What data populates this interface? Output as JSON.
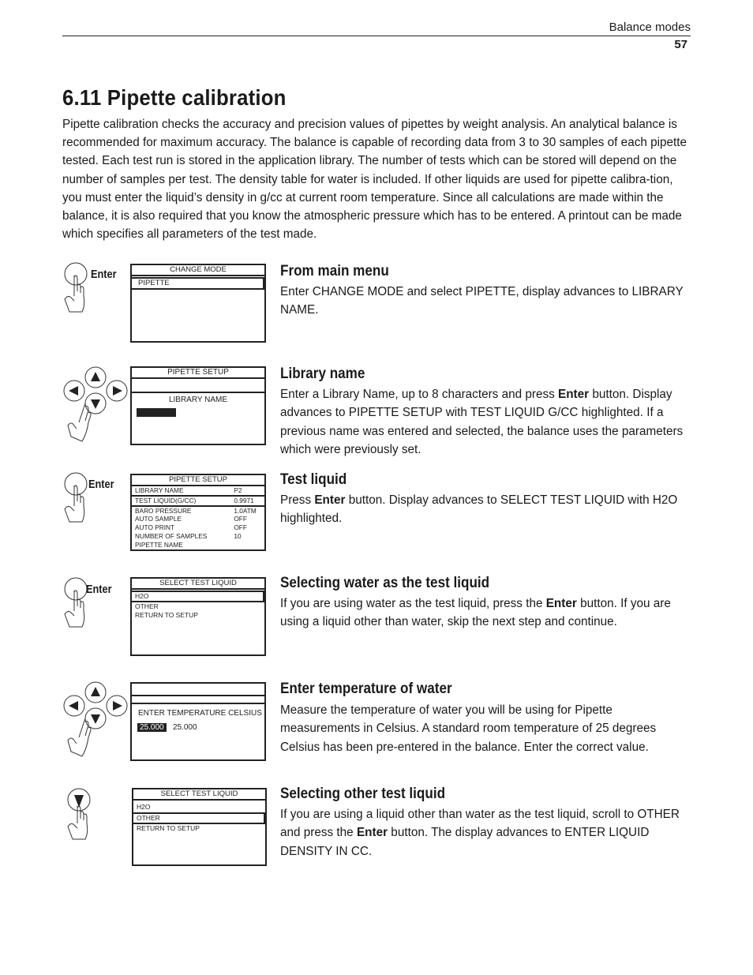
{
  "header": {
    "section": "Balance modes",
    "page_number": "57"
  },
  "title": "6.11 Pipette calibration",
  "intro": "Pipette calibration checks the accuracy and precision values of pipettes by weight analysis. An analytical balance is recommended for maximum accuracy. The balance is capable of recording data from 3 to 30 samples of each pipette tested. Each test run is stored in the application library. The number of tests which can be stored will depend on the number of samples per test. The density table for water is included. If other liquids are used for pipette calibra-tion, you must enter the liquid’s density in g/cc at current room temperature. Since all calculations are made within the balance, it is also required that you know the atmospheric pressure which has to be entered. A printout can be made which specifies all parameters of the test made.",
  "steps": [
    {
      "heading": "From main menu",
      "text": "Enter CHANGE MODE and select PIPETTE, display advances to LIBRARY NAME.",
      "key": {
        "type": "enter-button",
        "label": "Enter"
      },
      "display": {
        "header": "CHANGE MODE",
        "rows": [
          "PIPETTE"
        ],
        "selected": "PIPETTE"
      }
    },
    {
      "heading": "Library name",
      "text_parts": [
        "Enter a Library Name, up to 8 characters and press ",
        "Enter",
        " button. Display advances to PIPETTE SETUP with TEST LIQUID G/CC highlighted. If a previous name was entered and selected, the balance uses the parameters which were previously set."
      ],
      "key": {
        "type": "arrow-keypad"
      },
      "display": {
        "header": "PIPETTE SETUP",
        "prompt": "LIBRARY NAME",
        "input_value": ""
      }
    },
    {
      "heading": "Test liquid",
      "text_parts": [
        "Press ",
        "Enter",
        " button. Display advances to SELECT TEST LIQUID with H2O highlighted."
      ],
      "key": {
        "type": "enter-button",
        "label": "Enter"
      },
      "display": {
        "header": "PIPETTE SETUP",
        "rows": [
          {
            "label": "LIBRARY NAME",
            "value": "P2"
          },
          {
            "label": "TEST LIQUID(G/CC)",
            "value": "0.9971"
          },
          {
            "label": "BARO PRESSURE",
            "value": "1.0ATM"
          },
          {
            "label": "AUTO SAMPLE",
            "value": "OFF"
          },
          {
            "label": "AUTO PRINT",
            "value": "OFF"
          },
          {
            "label": "NUMBER OF SAMPLES",
            "value": "10"
          },
          {
            "label": "PIPETTE NAME",
            "value": ""
          }
        ],
        "selected": "TEST LIQUID(G/CC)"
      }
    },
    {
      "heading": "Selecting water as the test liquid",
      "text_parts": [
        "If you are using water as the test liquid, press the ",
        "Enter",
        " button. If you are using a liquid other than water, skip the next step and continue."
      ],
      "key": {
        "type": "enter-button",
        "label": "Enter"
      },
      "display": {
        "header": "SELECT TEST LIQUID",
        "rows": [
          "H2O",
          "OTHER",
          "RETURN TO SETUP"
        ],
        "selected": "H2O"
      }
    },
    {
      "heading": "Enter temperature of water",
      "text": "Measure the temperature of water you will be using for Pipette measurements in Celsius. A standard room temperature of 25 degrees Celsius has been pre-entered in the balance. Enter the correct value.",
      "key": {
        "type": "arrow-keypad"
      },
      "display": {
        "header": "",
        "prompt": "ENTER TEMPERATURE CELSIUS",
        "input_value": "25.000",
        "current_value": "25.000"
      }
    },
    {
      "heading": "Selecting other test liquid",
      "text_parts": [
        "If you are using a liquid other than water as the test liquid, scroll to OTHER and press the ",
        "Enter",
        " button. The display advances to ENTER LIQUID DENSITY IN CC."
      ],
      "key": {
        "type": "down-button"
      },
      "display": {
        "header": "SELECT TEST LIQUID",
        "rows": [
          "H2O",
          "OTHER",
          "RETURN TO SETUP"
        ],
        "selected": "OTHER"
      }
    }
  ]
}
